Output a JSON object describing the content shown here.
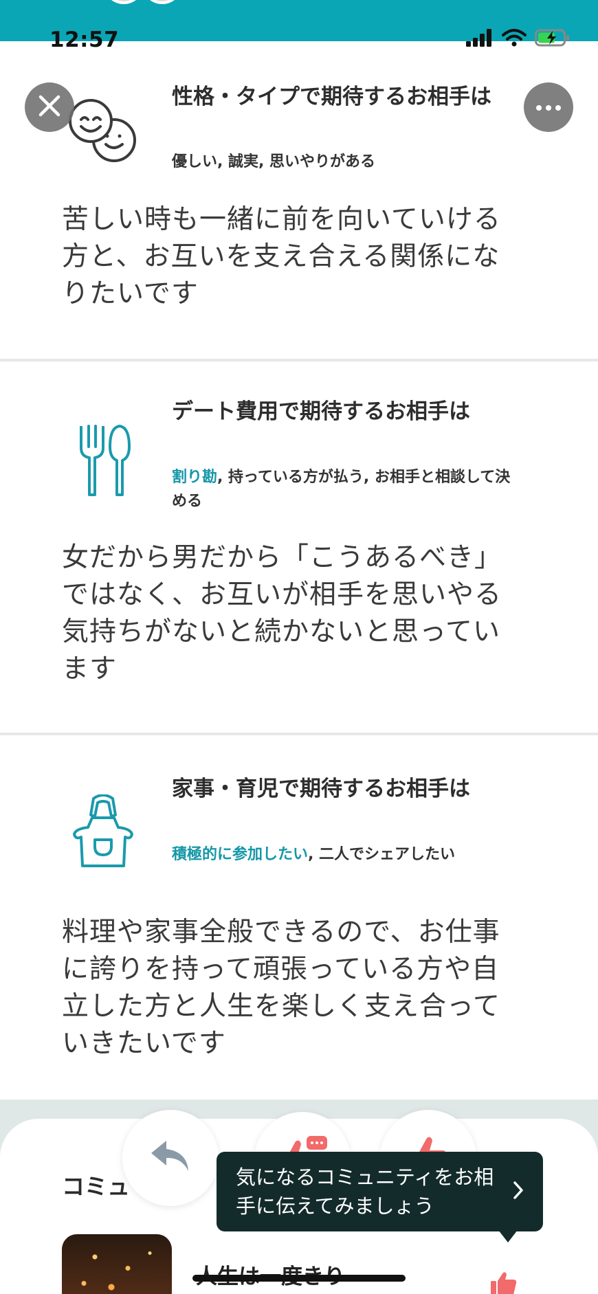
{
  "status_bar": {
    "time": "12:57"
  },
  "header": {
    "close_icon": "close-icon",
    "more_icon": "more-horizontal-icon"
  },
  "sections": [
    {
      "icon": "two-smiling-faces-icon",
      "title": "性格・タイプで期待するお相手は",
      "answer_highlight": "",
      "answer_rest": "優しい, 誠実, 思いやりがある",
      "body": "苦しい時も一緒に前を向いていける方と、お互いを支え合える関係になりたいです"
    },
    {
      "icon": "fork-spoon-icon",
      "title": "デート費用で期待するお相手は",
      "answer_highlight": "割り勘",
      "answer_rest": ", 持っている方が払う, お相手と相談して決める",
      "body": "女だから男だから「こうあるべき」ではなく、お互いが相手を思いやる気持ちがないと続かないと思っています"
    },
    {
      "icon": "apron-icon",
      "title": "家事・育児で期待するお相手は",
      "answer_highlight": "積極的に参加したい",
      "answer_rest": ", 二人でシェアしたい",
      "body": "料理や家事全般できるので、お仕事に誇りを持って頑張っている方や自立した方と人生を楽しく支え合っていきたいです"
    }
  ],
  "actions": {
    "tooltip_text": "気になるコミュニティをお相手に伝えてみましょう"
  },
  "community": {
    "label": "コミュ",
    "item_title": "人生は一度きり"
  },
  "colors": {
    "teal": "#0aa6b5",
    "accent_red": "#f26a6a",
    "highlight": "#1497a8"
  }
}
